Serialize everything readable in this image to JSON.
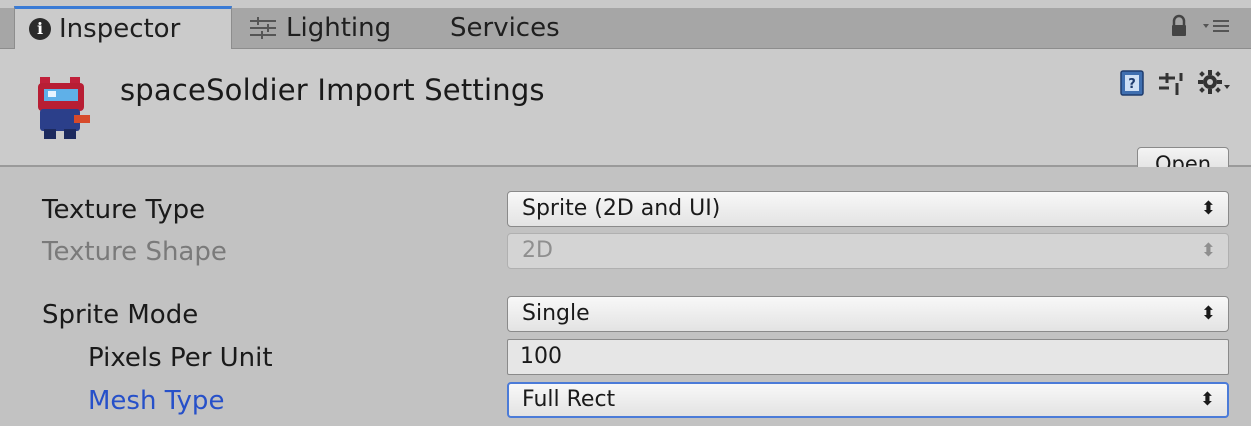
{
  "tabs": [
    {
      "label": "Inspector",
      "icon": "info-icon"
    },
    {
      "label": "Lighting",
      "icon": "lighting-icon"
    },
    {
      "label": "Services"
    }
  ],
  "header": {
    "title": "spaceSoldier Import Settings",
    "open_label": "Open"
  },
  "properties": {
    "texture_type": {
      "label": "Texture Type",
      "value": "Sprite (2D and UI)"
    },
    "texture_shape": {
      "label": "Texture Shape",
      "value": "2D"
    },
    "sprite_mode": {
      "label": "Sprite Mode",
      "value": "Single"
    },
    "pixels_per_unit": {
      "label": "Pixels Per Unit",
      "value": "100"
    },
    "mesh_type": {
      "label": "Mesh Type",
      "value": "Full Rect"
    }
  },
  "colors": {
    "accent": "#3a7bd5",
    "highlight_label": "#2650c9",
    "focus_border": "#4b7bd8"
  },
  "glyphs": {
    "dropdown_arrows": "⬍"
  }
}
